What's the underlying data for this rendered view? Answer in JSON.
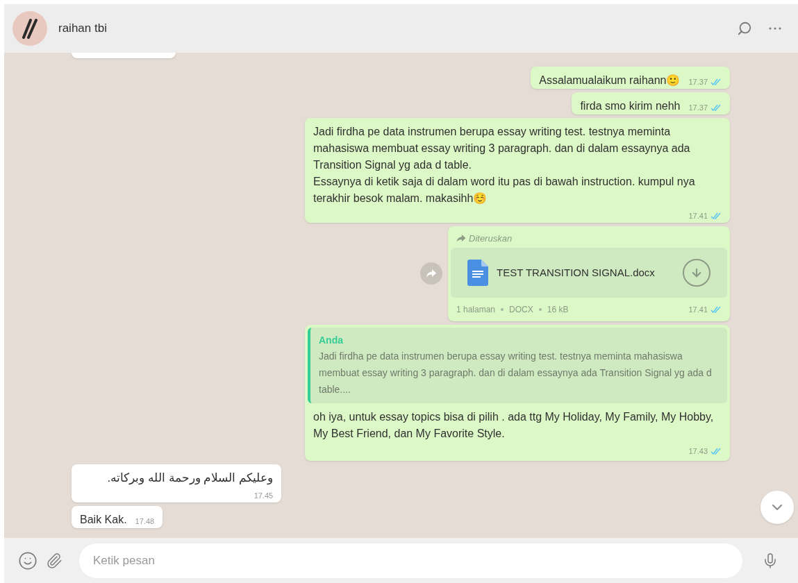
{
  "header": {
    "contact_name": "raihan tbi"
  },
  "messages": [
    {
      "kind": "text",
      "outgoing": true,
      "text": "Assalamualaikum raihann🙂",
      "time": "17.37",
      "read": true
    },
    {
      "kind": "text",
      "outgoing": true,
      "text": "firda smo kirim nehh",
      "time": "17.37",
      "read": true
    },
    {
      "kind": "text",
      "outgoing": true,
      "text": "Jadi firdha pe data instrumen berupa essay writing test. testnya meminta mahasiswa membuat essay writing 3 paragraph. dan di dalam essaynya ada Transition Signal yg ada d table.\nEssaynya di ketik saja di dalam word itu pas di bawah instruction. kumpul nya terakhir besok malam. makasihh☺️",
      "time": "17.41",
      "read": true
    },
    {
      "kind": "document",
      "outgoing": true,
      "forwarded_label": "Diteruskan",
      "file_name": "TEST TRANSITION SIGNAL.docx",
      "meta": [
        "1 halaman",
        "DOCX",
        "16 kB"
      ],
      "time": "17.41",
      "read": true
    },
    {
      "kind": "quoted",
      "outgoing": true,
      "quote_author": "Anda",
      "quote_text": "Jadi firdha pe data instrumen berupa essay writing test. testnya meminta mahasiswa membuat essay writing 3 paragraph. dan di dalam essaynya ada Transition Signal yg ada d table....",
      "text": "oh iya, untuk essay topics bisa di pilih . ada ttg My Holiday, My Family, My Hobby, My Best Friend, dan My Favorite Style.",
      "time": "17.43",
      "read": true
    },
    {
      "kind": "arabic",
      "outgoing": false,
      "text": "وعليكم السلام ورحمة الله وبركاته.",
      "time": "17.45"
    },
    {
      "kind": "text",
      "outgoing": false,
      "text": "Baik Kak.",
      "time": "17.48"
    }
  ],
  "composer": {
    "placeholder": "Ketik pesan"
  }
}
